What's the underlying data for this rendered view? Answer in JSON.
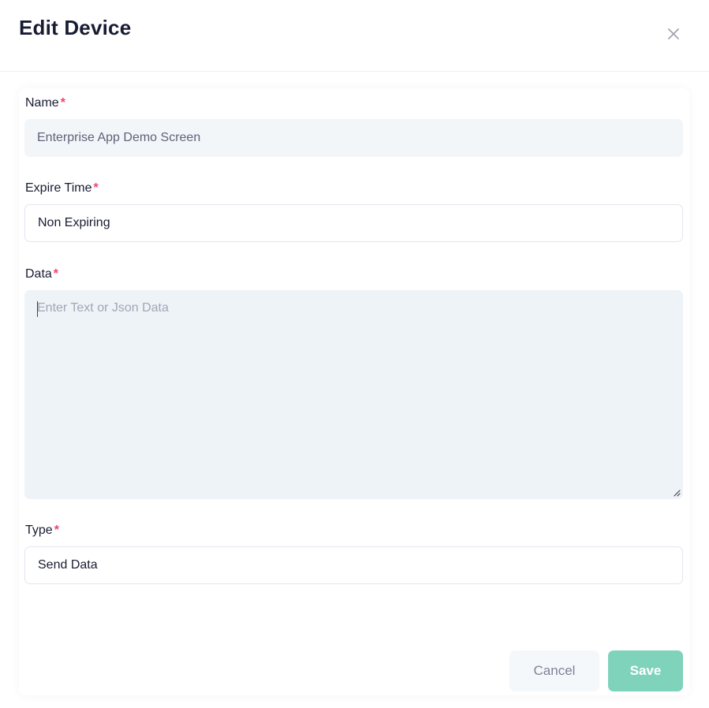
{
  "modal": {
    "title": "Edit Device",
    "close_icon": "close-icon"
  },
  "form": {
    "name": {
      "label": "Name",
      "required_mark": "*",
      "value": "Enterprise App Demo Screen"
    },
    "expire_time": {
      "label": "Expire Time",
      "required_mark": "*",
      "value": "Non Expiring"
    },
    "data": {
      "label": "Data",
      "required_mark": "*",
      "placeholder": "Enter Text or Json Data",
      "value": ""
    },
    "type": {
      "label": "Type",
      "required_mark": "*",
      "value": "Send Data"
    }
  },
  "actions": {
    "cancel_label": "Cancel",
    "save_label": "Save"
  },
  "colors": {
    "required": "#f1416c",
    "save_button": "#7fd3bb",
    "cancel_button": "#f5f8fa",
    "title": "#181c32"
  }
}
